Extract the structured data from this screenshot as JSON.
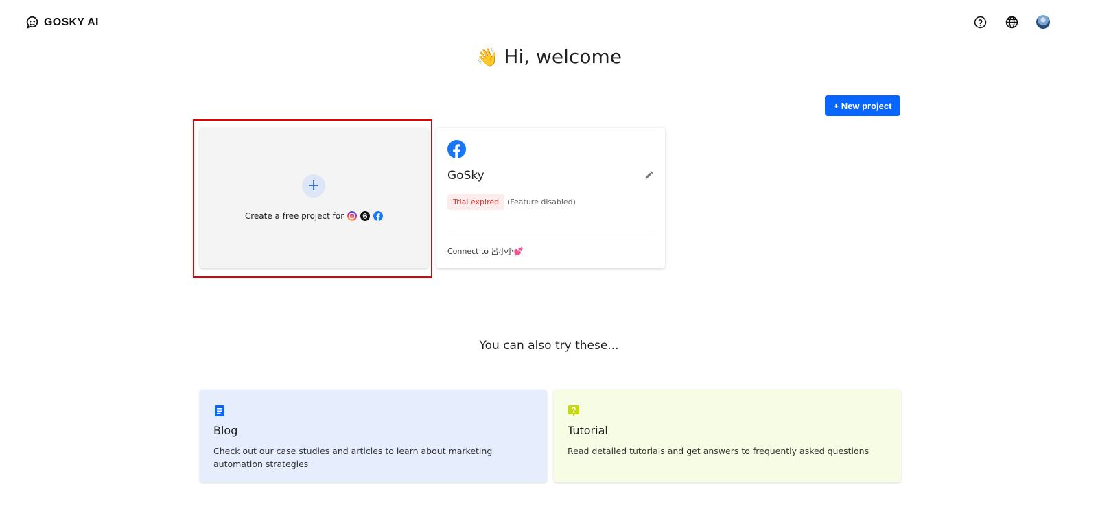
{
  "header": {
    "logo_text": "GOSKY AI",
    "icons": [
      "help-icon",
      "globe-icon",
      "avatar"
    ]
  },
  "welcome": {
    "emoji": "👋",
    "text": "Hi, welcome"
  },
  "new_project_label": "+ New project",
  "create_card": {
    "plus": "+",
    "text": "Create a free project for",
    "platform_icons": [
      "instagram-icon",
      "threads-icon",
      "facebook-icon"
    ]
  },
  "project": {
    "platform": "facebook",
    "name": "GoSky",
    "status": "Trial expired",
    "status_note": "(Feature disabled)",
    "connect_prefix": "Connect to",
    "connect_account": "呂小小💕",
    "status_color": "#e53935"
  },
  "try_title": "You can also try these...",
  "tiles": [
    {
      "title": "Blog",
      "desc": "Check out our case studies and articles to learn about marketing automation strategies",
      "icon": "document-icon",
      "color": "#e6eefd"
    },
    {
      "title": "Tutorial",
      "desc": "Read detailed tutorials and get answers to frequently asked questions",
      "icon": "question-icon",
      "color": "#f7fce4"
    }
  ],
  "colors": {
    "accent": "#0866ff",
    "highlight": "#e60000"
  }
}
